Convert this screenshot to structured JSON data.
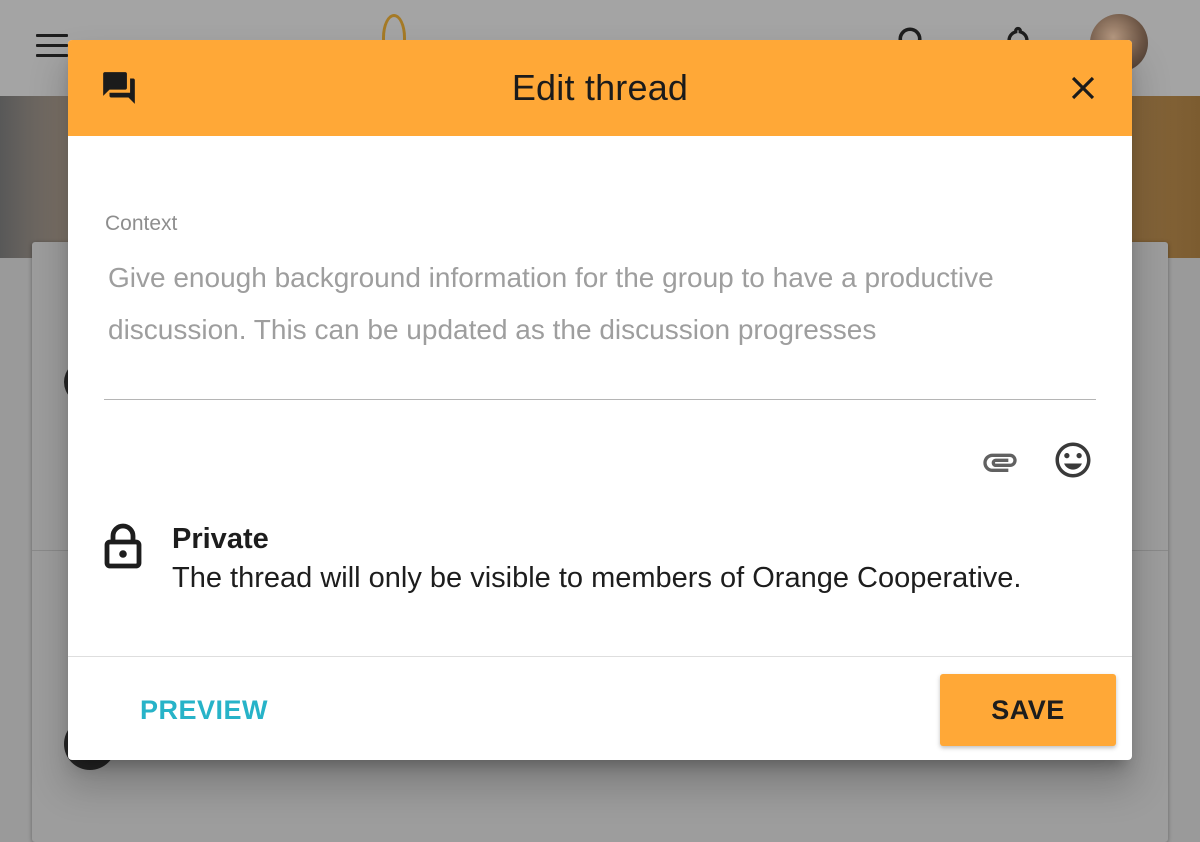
{
  "dialog": {
    "title": "Edit thread",
    "header_color": "#ffa837",
    "header_icon": "forum-icon",
    "close_icon": "close-icon"
  },
  "context_field": {
    "label": "Context",
    "value": "",
    "placeholder": "Give enough background information for the group to have a productive discussion. This can be updated as the discussion progresses"
  },
  "toolbar": {
    "icons": [
      "attachment-icon",
      "emoji-icon"
    ]
  },
  "privacy": {
    "icon": "lock-icon",
    "title": "Private",
    "description": "The thread will only be visible to members of Orange Cooperative."
  },
  "actions": {
    "preview_label": "PREVIEW",
    "save_label": "SAVE",
    "preview_color": "#27b3c8",
    "save_color": "#ffa837"
  }
}
